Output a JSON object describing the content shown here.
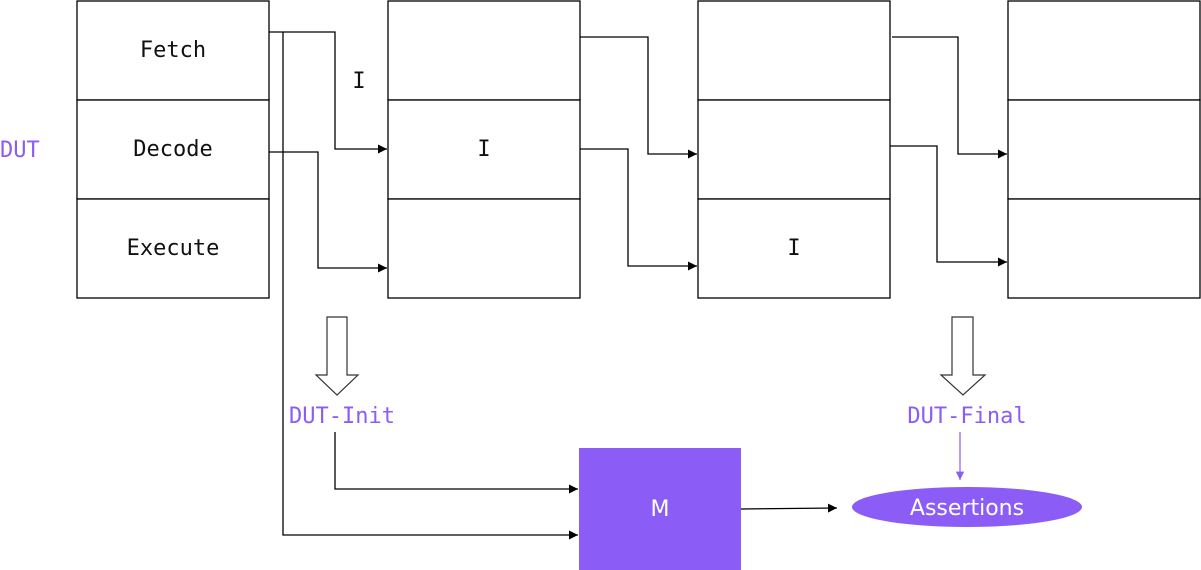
{
  "diagram": {
    "dut_label": "DUT",
    "stage0": {
      "rows": [
        "Fetch",
        "Decode",
        "Execute"
      ]
    },
    "stage1": {
      "rows": [
        "",
        "I",
        ""
      ]
    },
    "stage2": {
      "rows": [
        "",
        "",
        "I"
      ]
    },
    "stage3": {
      "rows": [
        "",
        "",
        ""
      ]
    },
    "wire_label": "I",
    "dut_init_label": "DUT-Init",
    "dut_final_label": "DUT-Final",
    "model_label": "M",
    "assertions_label": "Assertions",
    "colors": {
      "accent": "#8b5cf6",
      "stroke": "#000000"
    }
  }
}
